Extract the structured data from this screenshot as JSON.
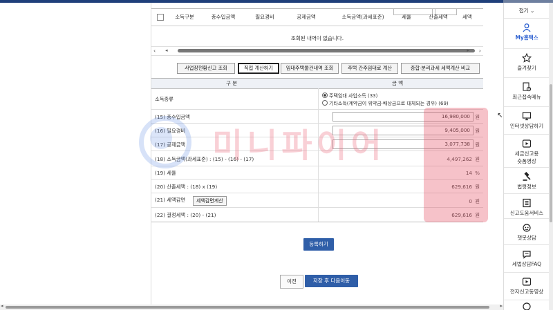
{
  "upper_table": {
    "headers": [
      "소득구분",
      "총수입금액",
      "필요경비",
      "공제금액",
      "소득금액(과세표준)",
      "세율",
      "산출세액",
      "세액"
    ],
    "empty_message": "조회된 내역이 없습니다."
  },
  "action_buttons": [
    "사업장현황신고 조회",
    "직접 계산하기",
    "임대주택물건내역 조회",
    "주택 간주임대료 계산",
    "종합·분리과세 세액계산 비교"
  ],
  "form": {
    "header_left": "구 분",
    "header_right": "금 액",
    "income_type_label": "소득종류",
    "radio1": "주택임대 사업소득 (33)",
    "radio2": "기타소득(계약금이 위약금·배상금으로 대체되는 경우) (69)",
    "rows": {
      "r15_label": "(15) 총수입금액",
      "r15_value": "16,980,000",
      "r15_unit": "원",
      "r16_label": "(16) 필요경비",
      "r16_value": "9,405,000",
      "r16_unit": "원",
      "r17_label": "(17) 공제금액",
      "r17_value": "3,077,738",
      "r17_unit": "원",
      "r18_label": "(18) 소득금액(과세표준) : (15) - (16) - (17)",
      "r18_value": "4,497,262",
      "r18_unit": "원",
      "r19_label": "(19) 세율",
      "r19_value": "14",
      "r19_unit": "%",
      "r20_label": "(20) 산출세액 : (18) x (19)",
      "r20_value": "629,616",
      "r20_unit": "원",
      "r21_label": "(21) 세액감면",
      "r21_button": "세액감면계산",
      "r21_value": "0",
      "r21_unit": "원",
      "r22_label": "(22) 결정세액 : (20) - (21)",
      "r22_value": "629,616",
      "r22_unit": "원"
    }
  },
  "register_button": "등록하기",
  "prev_button": "이전",
  "save_next_button": "저장 후 다음이동",
  "watermark_text": "미니파이어",
  "sidebar": {
    "collapse_label": "접기",
    "items": [
      {
        "label": "My홈택스",
        "icon": "person-icon"
      },
      {
        "label": "즐겨찾기",
        "icon": "star-icon"
      },
      {
        "label": "최근접속메뉴",
        "icon": "recent-doc-icon"
      },
      {
        "label": "인터넷상담하기",
        "icon": "monitor-icon"
      },
      {
        "label": "세금신고용 숏폼영상",
        "label_line1": "세금신고용",
        "label_line2": "숏폼영상",
        "icon": "play-icon"
      },
      {
        "label": "법령정보",
        "icon": "gavel-icon"
      },
      {
        "label": "신고도움서비스",
        "icon": "book-icon"
      },
      {
        "label": "챗봇상담",
        "icon": "chatbot-icon"
      },
      {
        "label": "세법상담FAQ",
        "icon": "chat-icon"
      },
      {
        "label": "전자신고동영상",
        "icon": "play-icon"
      }
    ]
  },
  "colors": {
    "primary": "#2f5ea8",
    "highlight": "#e65064",
    "selected_sidebar": "#2b5fd0"
  }
}
